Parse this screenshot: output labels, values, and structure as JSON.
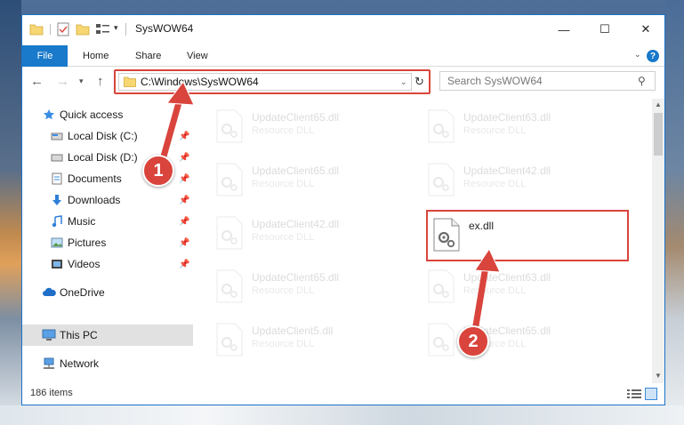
{
  "window": {
    "title": "SysWOW64",
    "controls": {
      "minimize": "—",
      "maximize": "☐",
      "close": "✕"
    }
  },
  "ribbon": {
    "file": "File",
    "home": "Home",
    "share": "Share",
    "view": "View",
    "help": "?"
  },
  "nav": {
    "address": "C:\\Windows\\SysWOW64",
    "search_placeholder": "Search SysWOW64"
  },
  "sidebar": {
    "items": [
      {
        "label": "Quick access",
        "icon": "star-icon",
        "pinned": false
      },
      {
        "label": "Local Disk (C:)",
        "icon": "drive-icon",
        "pinned": true
      },
      {
        "label": "Local Disk (D:)",
        "icon": "drive-icon",
        "pinned": true
      },
      {
        "label": "Documents",
        "icon": "documents-icon",
        "pinned": true
      },
      {
        "label": "Downloads",
        "icon": "download-icon",
        "pinned": true
      },
      {
        "label": "Music",
        "icon": "music-icon",
        "pinned": true
      },
      {
        "label": "Pictures",
        "icon": "pictures-icon",
        "pinned": true
      },
      {
        "label": "Videos",
        "icon": "videos-icon",
        "pinned": true
      },
      {
        "label": "OneDrive",
        "icon": "cloud-icon",
        "pinned": false
      },
      {
        "label": "This PC",
        "icon": "computer-icon",
        "pinned": false,
        "selected": true
      },
      {
        "label": "Network",
        "icon": "network-icon",
        "pinned": false
      }
    ]
  },
  "files": [
    {
      "name": "UpdateClient65.dll",
      "type": "Resource DLL",
      "faded": true
    },
    {
      "name": "UpdateClient63.dll",
      "type": "Resource DLL",
      "faded": true
    },
    {
      "name": "UpdateClient65.dll",
      "type": "Resource DLL",
      "faded": true
    },
    {
      "name": "UpdateClient42.dll",
      "type": "Resource DLL",
      "faded": true
    },
    {
      "name": "UpdateClient42.dll",
      "type": "Resource DLL",
      "faded": true
    },
    {
      "name": "ex.dll",
      "type": "",
      "faded": false,
      "highlighted": true
    },
    {
      "name": "UpdateClient65.dll",
      "type": "Resource DLL",
      "faded": true
    },
    {
      "name": "UpdateClient63.dll",
      "type": "Resource DLL",
      "faded": true
    },
    {
      "name": "UpdateClient5.dll",
      "type": "Resource DLL",
      "faded": true
    },
    {
      "name": "UpdateClient65.dll",
      "type": "Resource DLL",
      "faded": true
    }
  ],
  "status": {
    "item_count": "186 items"
  },
  "annotations": {
    "step1": "1",
    "step2": "2"
  },
  "colors": {
    "accent": "#1979ca",
    "highlight": "#d9443c"
  }
}
